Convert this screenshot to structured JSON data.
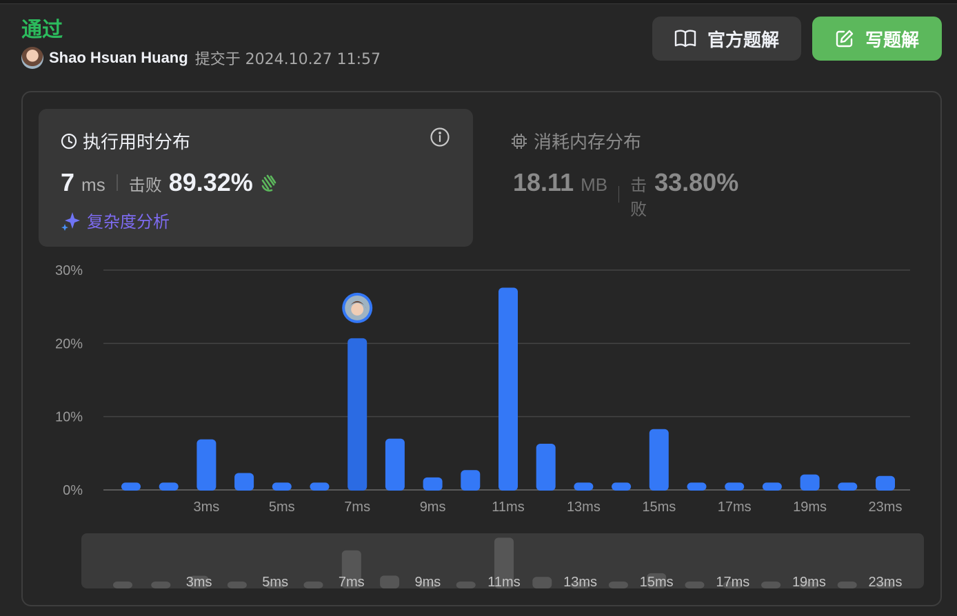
{
  "header": {
    "status": "通过",
    "user": "Shao Hsuan Huang",
    "submitted": "提交于 2024.10.27 11:57"
  },
  "buttons": {
    "official_solution": "官方题解",
    "write_solution": "写题解"
  },
  "runtime": {
    "title": "执行用时分布",
    "value": "7",
    "unit": "ms",
    "beats_label": "击败",
    "beats_value": "89.32%",
    "complexity_label": "复杂度分析"
  },
  "memory": {
    "title": "消耗内存分布",
    "value": "18.11",
    "unit": "MB",
    "beats_label": "击败",
    "beats_value": "33.80%"
  },
  "colors": {
    "accept": "#2cbb5d",
    "bar": "#3478f6",
    "bar_selected": "#2b6be3",
    "write_button": "#5cb85c",
    "complexity": "#7d6bf0"
  },
  "chart_data": {
    "type": "bar",
    "ylim": [
      0,
      30
    ],
    "yticks": [
      "0%",
      "10%",
      "20%",
      "30%"
    ],
    "grid": true,
    "selected_index": 6,
    "values": [
      1.0,
      1.0,
      6.9,
      2.3,
      1.0,
      1.0,
      20.7,
      7.0,
      1.7,
      2.7,
      27.6,
      6.3,
      1.0,
      1.0,
      8.3,
      1.0,
      1.0,
      1.0,
      2.1,
      1.0,
      1.9
    ],
    "xtick_labels": [
      "3ms",
      "5ms",
      "7ms",
      "9ms",
      "11ms",
      "13ms",
      "15ms",
      "17ms",
      "19ms",
      "23ms"
    ],
    "xtick_bar_index": [
      2,
      4,
      6,
      8,
      10,
      12,
      14,
      16,
      18,
      20
    ]
  }
}
